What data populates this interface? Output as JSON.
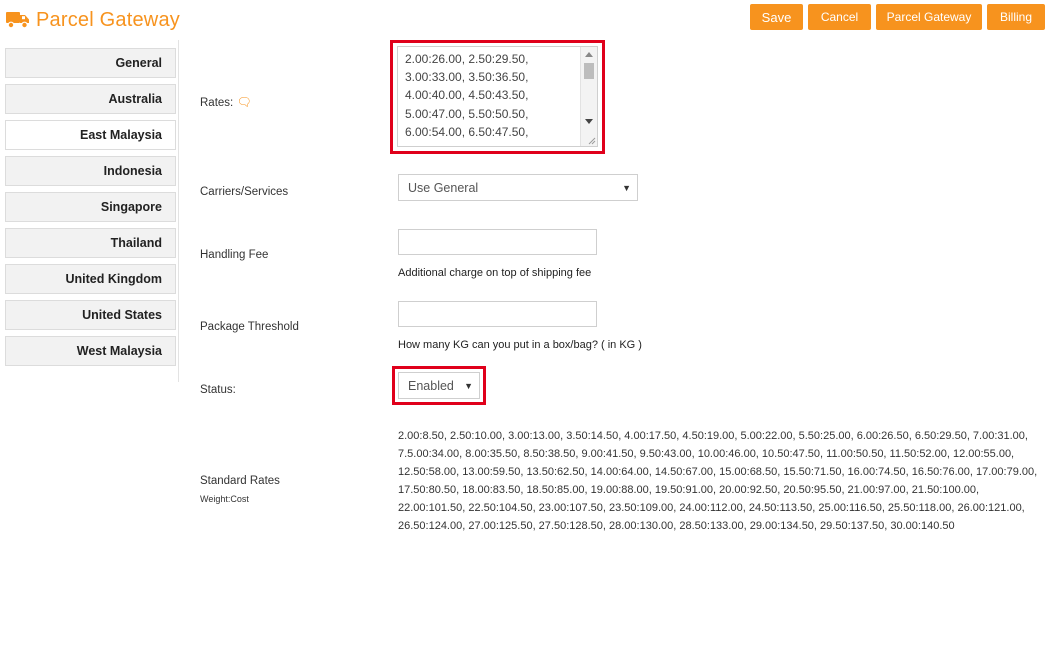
{
  "brand": {
    "name": "Parcel Gateway",
    "icon": "truck-icon",
    "color": "#f7931e"
  },
  "toolbar": {
    "save_label": "Save",
    "cancel_label": "Cancel",
    "parcel_gateway_label": "Parcel Gateway",
    "billing_label": "Billing"
  },
  "sidebar": {
    "items": [
      {
        "label": "General"
      },
      {
        "label": "Australia"
      },
      {
        "label": "East Malaysia",
        "active": true
      },
      {
        "label": "Indonesia"
      },
      {
        "label": "Singapore"
      },
      {
        "label": "Thailand"
      },
      {
        "label": "United Kingdom"
      },
      {
        "label": "United States"
      },
      {
        "label": "West Malaysia"
      }
    ]
  },
  "form": {
    "rates": {
      "label": "Rates:",
      "value": "2.00:26.00, 2.50:29.50, 3.00:33.00, 3.50:36.50, 4.00:40.00, 4.50:43.50, 5.00:47.00, 5.50:50.50, 6.00:54.00, 6.50:47.50,"
    },
    "carriers": {
      "label": "Carriers/Services",
      "selected": "Use General"
    },
    "handling_fee": {
      "label": "Handling Fee",
      "value": "",
      "help": "Additional charge on top of shipping fee"
    },
    "package_threshold": {
      "label": "Package Threshold",
      "value": "",
      "help": "How many KG can you put in a box/bag? ( in KG )"
    },
    "status": {
      "label": "Status:",
      "selected": "Enabled"
    },
    "standard_rates": {
      "label": "Standard Rates",
      "sublabel": "Weight:Cost",
      "value": "2.00:8.50, 2.50:10.00, 3.00:13.00, 3.50:14.50, 4.00:17.50, 4.50:19.00, 5.00:22.00, 5.50:25.00, 6.00:26.50, 6.50:29.50, 7.00:31.00, 7.5.00:34.00, 8.00:35.50, 8.50:38.50, 9.00:41.50, 9.50:43.00, 10.00:46.00, 10.50:47.50, 11.00:50.50, 11.50:52.00, 12.00:55.00, 12.50:58.00, 13.00:59.50, 13.50:62.50, 14.00:64.00, 14.50:67.00, 15.00:68.50, 15.50:71.50, 16.00:74.50, 16.50:76.00, 17.00:79.00, 17.50:80.50, 18.00:83.50, 18.50:85.00, 19.00:88.00, 19.50:91.00, 20.00:92.50, 20.50:95.50, 21.00:97.00, 21.50:100.00, 22.00:101.50, 22.50:104.50, 23.00:107.50, 23.50:109.00, 24.00:112.00, 24.50:113.50, 25.00:116.50, 25.50:118.00, 26.00:121.00, 26.50:124.00, 27.00:125.50, 27.50:128.50, 28.00:130.00, 28.50:133.00, 29.00:134.50, 29.50:137.50, 30.00:140.50"
    }
  },
  "colors": {
    "accent": "#f7931e",
    "highlight": "#e0001b"
  }
}
